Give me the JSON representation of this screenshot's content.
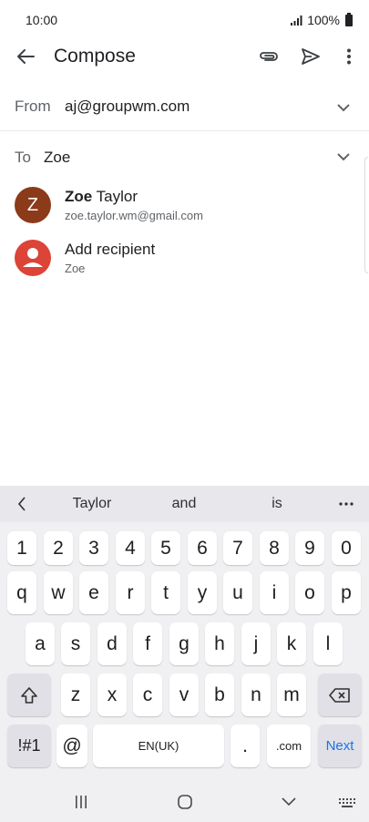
{
  "status_bar": {
    "time": "10:00",
    "battery": "100%"
  },
  "app_bar": {
    "title": "Compose"
  },
  "from": {
    "label": "From",
    "value": "aj@groupwm.com"
  },
  "to": {
    "label": "To",
    "value": "Zoe"
  },
  "suggestions": [
    {
      "avatar_letter": "Z",
      "name_bold": "Zoe",
      "name_rest": " Taylor",
      "email": "zoe.taylor.wm@gmail.com",
      "avatar_color": "#8b3a1a"
    },
    {
      "name": "Add recipient",
      "sub": "Zoe",
      "avatar_color": "#db4437"
    }
  ],
  "keyboard": {
    "suggestions": [
      "Taylor",
      "and",
      "is"
    ],
    "row_numbers": [
      "1",
      "2",
      "3",
      "4",
      "5",
      "6",
      "7",
      "8",
      "9",
      "0"
    ],
    "row_1": [
      "q",
      "w",
      "e",
      "r",
      "t",
      "y",
      "u",
      "i",
      "o",
      "p"
    ],
    "row_2": [
      "a",
      "s",
      "d",
      "f",
      "g",
      "h",
      "j",
      "k",
      "l"
    ],
    "row_3": [
      "z",
      "x",
      "c",
      "v",
      "b",
      "n",
      "m"
    ],
    "symbols_label": "!#1",
    "at_label": "@",
    "space_label": "EN(UK)",
    "period_label": ".",
    "com_label": ".com",
    "next_label": "Next"
  },
  "colors": {
    "accent": "#1a73e8",
    "keyboard_bg": "#f0f0f3"
  },
  "icons": {
    "back": "arrow-left-icon",
    "attach": "paperclip-icon",
    "send": "send-icon",
    "more": "more-vert-icon",
    "expand": "chevron-down-icon",
    "shift": "shift-icon",
    "backspace": "backspace-icon"
  }
}
